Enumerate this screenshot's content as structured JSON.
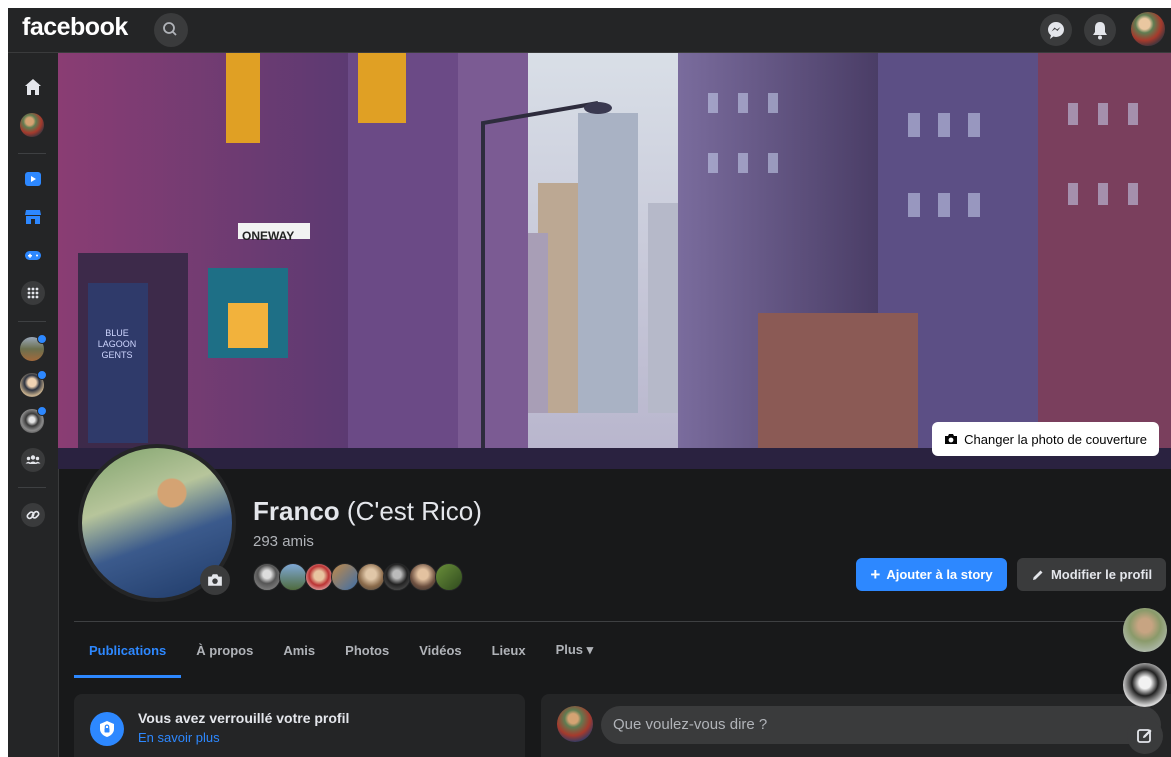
{
  "topbar": {
    "logo": "facebook",
    "icons": [
      "search-icon",
      "messenger-icon",
      "notifications-icon",
      "account-avatar"
    ]
  },
  "rail": {
    "icons": [
      "home-icon",
      "profile-avatar",
      "watch-icon",
      "marketplace-icon",
      "gaming-icon",
      "menu-grid-icon",
      "groups-icon",
      "link-icon"
    ],
    "groups_with_new_activity": 3
  },
  "cover": {
    "change_button": "Changer la photo de couverture",
    "sign_text": "ONEWAY",
    "shop_sign": "BLUE LAGOON GENTS"
  },
  "profile": {
    "name": "Franco",
    "alternate_name": "(C'est Rico)",
    "friends_count": "293 amis",
    "friend_faces": 8
  },
  "actions": {
    "add_story": "Ajouter à la story",
    "edit_profile": "Modifier le profil"
  },
  "tabs": [
    {
      "label": "Publications",
      "active": true
    },
    {
      "label": "À propos",
      "active": false
    },
    {
      "label": "Amis",
      "active": false
    },
    {
      "label": "Photos",
      "active": false
    },
    {
      "label": "Vidéos",
      "active": false
    },
    {
      "label": "Lieux",
      "active": false
    },
    {
      "label": "Plus ▾",
      "active": false
    }
  ],
  "lock_card": {
    "title": "Vous avez verrouillé votre profil",
    "link": "En savoir plus"
  },
  "composer": {
    "placeholder": "Que voulez-vous dire ?"
  },
  "colors": {
    "accent": "#2d88ff",
    "background": "#18191a",
    "surface": "#242526"
  }
}
